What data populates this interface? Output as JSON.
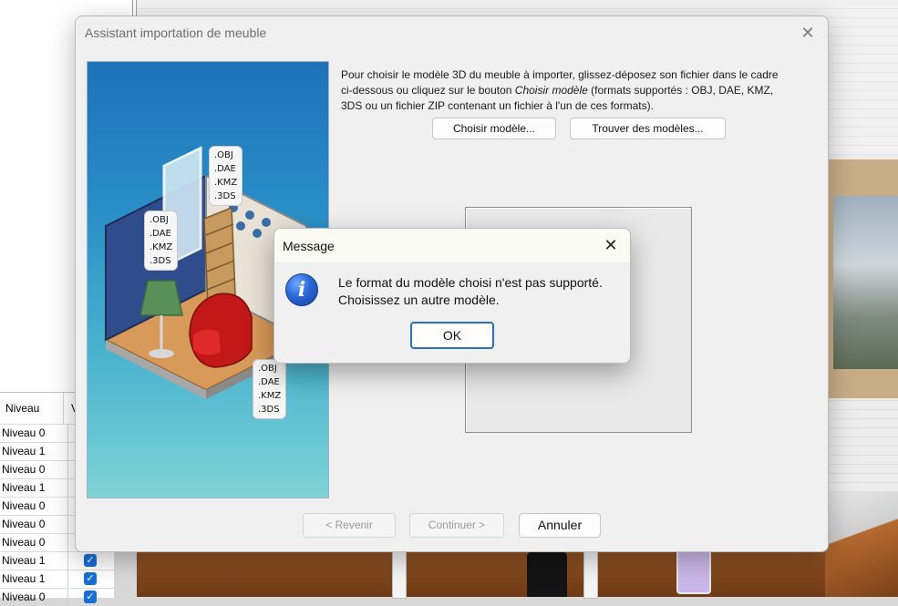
{
  "background": {
    "level_table": {
      "header_col1": "Niveau",
      "rows": [
        {
          "level": "Niveau 0",
          "checked": false
        },
        {
          "level": "Niveau 1",
          "checked": false
        },
        {
          "level": "Niveau 0",
          "checked": false
        },
        {
          "level": "Niveau 1",
          "checked": false
        },
        {
          "level": "Niveau 0",
          "checked": false
        },
        {
          "level": "Niveau 0",
          "checked": false
        },
        {
          "level": "Niveau 0",
          "checked": false
        },
        {
          "level": "Niveau 1",
          "checked": true
        },
        {
          "level": "Niveau 1",
          "checked": true
        },
        {
          "level": "Niveau 0",
          "checked": true
        }
      ]
    }
  },
  "wizard": {
    "title": "Assistant importation de meuble",
    "close_icon": "close-icon",
    "instructions_part1": "Pour choisir le modèle 3D du meuble à importer, glissez-déposez son fichier dans le cadre ci-dessous ou cliquez sur le bouton ",
    "instructions_em": "Choisir modèle",
    "instructions_part2": " (formats supportés : OBJ, DAE, KMZ, 3DS ou un fichier ZIP contenant un fichier à l'un de ces formats).",
    "choose_model_label": "Choisir modèle...",
    "find_models_label": "Trouver des modèles...",
    "back_label": "< Revenir",
    "continue_label": "Continuer >",
    "cancel_label": "Annuler",
    "callouts": {
      "top": [
        ".OBJ",
        ".DAE",
        ".KMZ",
        ".3DS"
      ],
      "left": [
        ".OBJ",
        ".DAE",
        ".KMZ",
        ".3DS"
      ],
      "bottom": [
        ".OBJ",
        ".DAE",
        ".KMZ",
        ".3DS"
      ]
    }
  },
  "message": {
    "title": "Message",
    "line1": "Le format du modèle choisi n'est pas supporté.",
    "line2": "Choisissez un autre modèle.",
    "ok_label": "OK",
    "icon": "info-icon"
  }
}
